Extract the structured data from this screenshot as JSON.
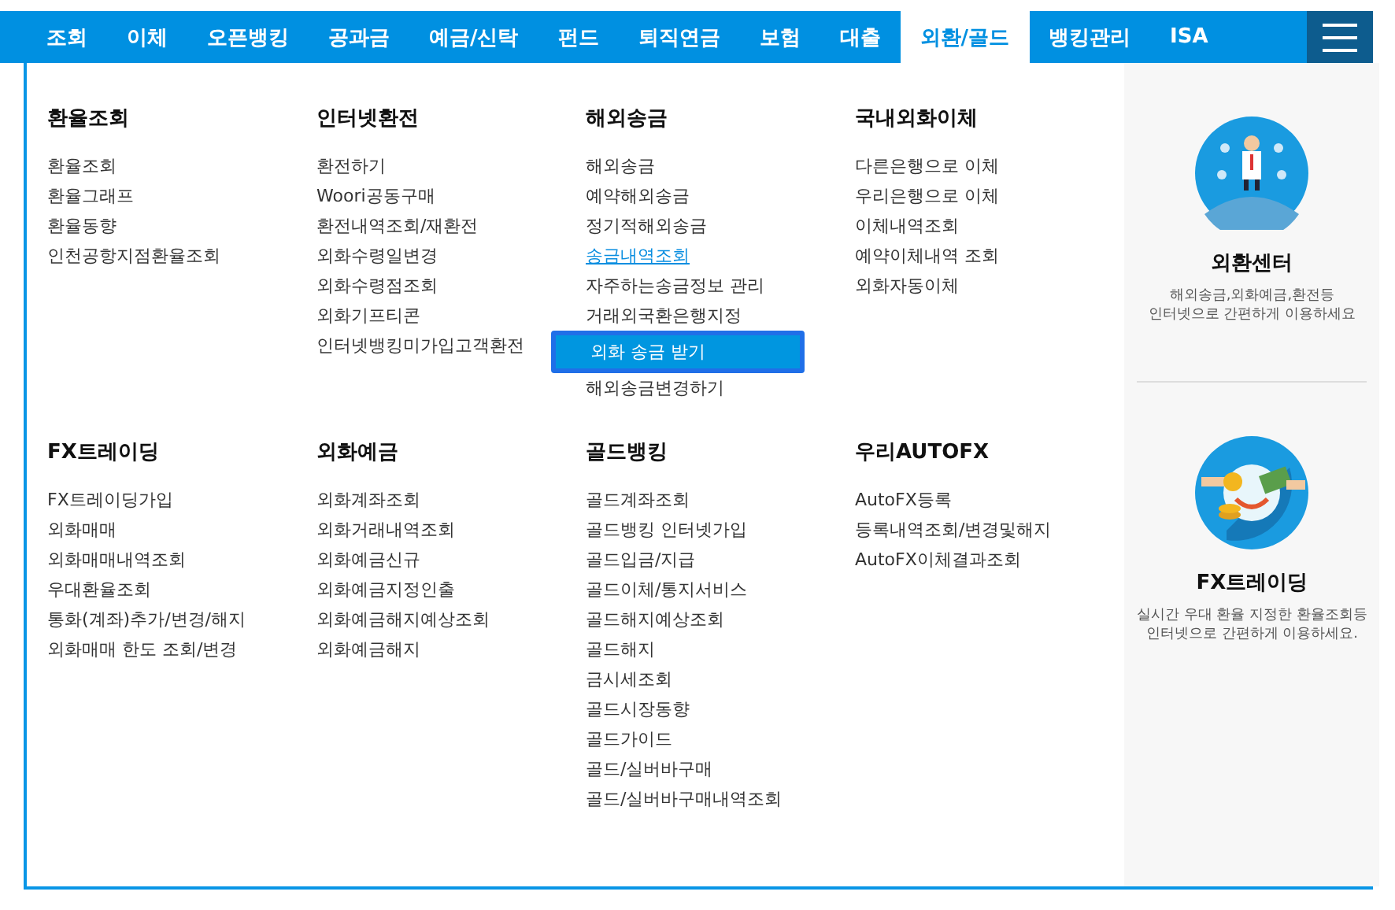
{
  "nav": {
    "tabs": [
      {
        "label": "조회",
        "selected": false
      },
      {
        "label": "이체",
        "selected": false
      },
      {
        "label": "오픈뱅킹",
        "selected": false
      },
      {
        "label": "공과금",
        "selected": false
      },
      {
        "label": "예금/신탁",
        "selected": false
      },
      {
        "label": "펀드",
        "selected": false
      },
      {
        "label": "퇴직연금",
        "selected": false
      },
      {
        "label": "보험",
        "selected": false
      },
      {
        "label": "대출",
        "selected": false
      },
      {
        "label": "외환/골드",
        "selected": true
      },
      {
        "label": "뱅킹관리",
        "selected": false
      },
      {
        "label": "ISA",
        "selected": false
      }
    ]
  },
  "menu": {
    "groups": [
      {
        "title": "환율조회",
        "items": [
          {
            "label": "환율조회",
            "current": false,
            "selected": false
          },
          {
            "label": "환율그래프",
            "current": false,
            "selected": false
          },
          {
            "label": "환율동향",
            "current": false,
            "selected": false
          },
          {
            "label": "인천공항지점환율조회",
            "current": false,
            "selected": false
          }
        ]
      },
      {
        "title": "인터넷환전",
        "items": [
          {
            "label": "환전하기",
            "current": false,
            "selected": false
          },
          {
            "label": "Woori공동구매",
            "current": false,
            "selected": false
          },
          {
            "label": "환전내역조회/재환전",
            "current": false,
            "selected": false
          },
          {
            "label": "외화수령일변경",
            "current": false,
            "selected": false
          },
          {
            "label": "외화수령점조회",
            "current": false,
            "selected": false
          },
          {
            "label": "외화기프티콘",
            "current": false,
            "selected": false
          },
          {
            "label": "인터넷뱅킹미가입고객환전",
            "current": false,
            "selected": false
          }
        ]
      },
      {
        "title": "해외송금",
        "items": [
          {
            "label": "해외송금",
            "current": false,
            "selected": false
          },
          {
            "label": "예약해외송금",
            "current": false,
            "selected": false
          },
          {
            "label": "정기적해외송금",
            "current": false,
            "selected": false
          },
          {
            "label": "송금내역조회",
            "current": true,
            "selected": false
          },
          {
            "label": "자주하는송금정보 관리",
            "current": false,
            "selected": false
          },
          {
            "label": "거래외국환은행지정",
            "current": false,
            "selected": false
          },
          {
            "label": "외화 송금 받기",
            "current": false,
            "selected": true
          },
          {
            "label": "해외송금변경하기",
            "current": false,
            "selected": false
          }
        ]
      },
      {
        "title": "국내외화이체",
        "items": [
          {
            "label": "다른은행으로 이체",
            "current": false,
            "selected": false
          },
          {
            "label": "우리은행으로 이체",
            "current": false,
            "selected": false
          },
          {
            "label": "이체내역조회",
            "current": false,
            "selected": false
          },
          {
            "label": "예약이체내역 조회",
            "current": false,
            "selected": false
          },
          {
            "label": "외화자동이체",
            "current": false,
            "selected": false
          }
        ]
      },
      {
        "title": "FX트레이딩",
        "items": [
          {
            "label": "FX트레이딩가입",
            "current": false,
            "selected": false
          },
          {
            "label": "외화매매",
            "current": false,
            "selected": false
          },
          {
            "label": "외화매매내역조회",
            "current": false,
            "selected": false
          },
          {
            "label": "우대환율조회",
            "current": false,
            "selected": false
          },
          {
            "label": "통화(계좌)추가/변경/해지",
            "current": false,
            "selected": false
          },
          {
            "label": "외화매매 한도 조회/변경",
            "current": false,
            "selected": false
          }
        ]
      },
      {
        "title": "외화예금",
        "items": [
          {
            "label": "외화계좌조회",
            "current": false,
            "selected": false
          },
          {
            "label": "외화거래내역조회",
            "current": false,
            "selected": false
          },
          {
            "label": "외화예금신규",
            "current": false,
            "selected": false
          },
          {
            "label": "외화예금지정인출",
            "current": false,
            "selected": false
          },
          {
            "label": "외화예금해지예상조회",
            "current": false,
            "selected": false
          },
          {
            "label": "외화예금해지",
            "current": false,
            "selected": false
          }
        ]
      },
      {
        "title": "골드뱅킹",
        "items": [
          {
            "label": "골드계좌조회",
            "current": false,
            "selected": false
          },
          {
            "label": "골드뱅킹 인터넷가입",
            "current": false,
            "selected": false
          },
          {
            "label": "골드입금/지급",
            "current": false,
            "selected": false
          },
          {
            "label": "골드이체/통지서비스",
            "current": false,
            "selected": false
          },
          {
            "label": "골드해지예상조회",
            "current": false,
            "selected": false
          },
          {
            "label": "골드해지",
            "current": false,
            "selected": false
          },
          {
            "label": "금시세조회",
            "current": false,
            "selected": false
          },
          {
            "label": "골드시장동향",
            "current": false,
            "selected": false
          },
          {
            "label": "골드가이드",
            "current": false,
            "selected": false
          },
          {
            "label": "골드/실버바구매",
            "current": false,
            "selected": false
          },
          {
            "label": "골드/실버바구매내역조회",
            "current": false,
            "selected": false
          }
        ]
      },
      {
        "title": "우리AUTOFX",
        "items": [
          {
            "label": "AutoFX등록",
            "current": false,
            "selected": false
          },
          {
            "label": "등록내역조회/변경및해지",
            "current": false,
            "selected": false
          },
          {
            "label": "AutoFX이체결과조회",
            "current": false,
            "selected": false
          }
        ]
      }
    ]
  },
  "promos": [
    {
      "kind": "center",
      "title": "외환센터",
      "lines": [
        "해외송금,외화예금,환전등",
        "인터넷으로 간편하게 이용하세요"
      ]
    },
    {
      "kind": "trading",
      "title": "FX트레이딩",
      "lines": [
        "실시간 우대 환율 지정한 환율조회등",
        "인터넷으로 간편하게 이용하세요."
      ]
    }
  ]
}
